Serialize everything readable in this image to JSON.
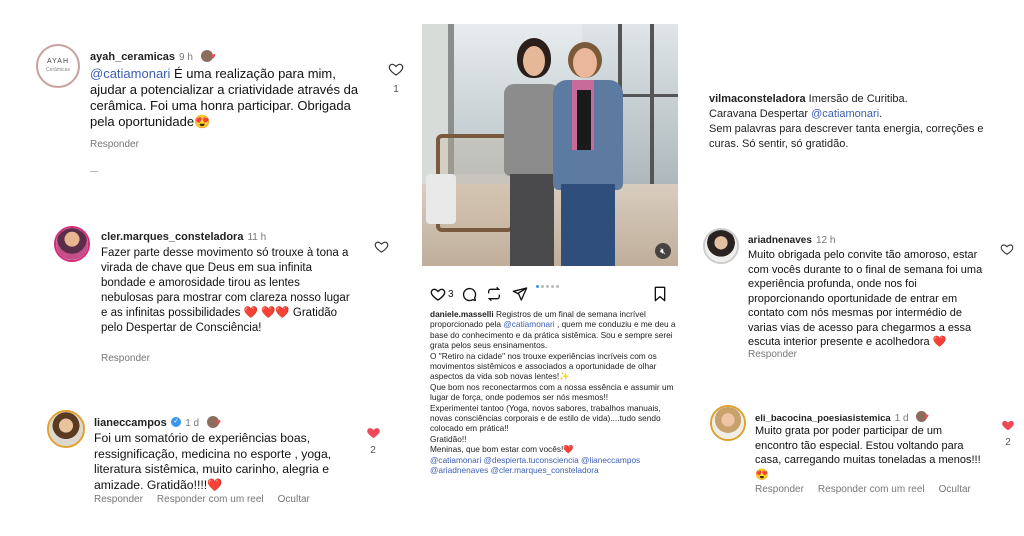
{
  "c1": {
    "username": "ayah_ceramicas",
    "ago": "9 h",
    "avatar_text": "AYAH",
    "avatar_sub": "Cerâmicas",
    "mention": "@catiamonari",
    "text_rest": " É uma realização para mim, ajudar a potencializar a criatividade através da cerâmica. Foi uma honra participar. Obrigada pela oportunidade😍",
    "reply": "Responder",
    "likes": "1"
  },
  "c2": {
    "username": "cler.marques_consteladora",
    "ago": "11 h",
    "text": "Fazer parte desse movimento só trouxe à tona a virada de chave que Deus em sua infinita bondade e amorosidade tirou as lentes nebulosas para mostrar com clareza nosso lugar e as infinitas possibilidades ❤️ ❤️❤️ Gratidão pelo Despertar de Consciência!",
    "reply": "Responder"
  },
  "c3": {
    "username": "lianeccampos",
    "ago": "1 d",
    "text": "Foi um somatório de experiências boas, ressignificação, medicina no esporte , yoga, literatura sistêmica, muito carinho, alegria e amizade. Gratidão!!!!❤️",
    "reply": "Responder",
    "reply_reel": "Responder com um reel",
    "hide": "Ocultar",
    "likes": "2"
  },
  "post": {
    "likes_count": "3",
    "username": "daniele.masselli",
    "caption_1": " Registros de um final de semana incrível proporcionado pela ",
    "caption_mention": "@catiamonari",
    "caption_2": " , quem me conduziu e me deu a base do conhecimento e da prática sistêmica. Sou e sempre serei grata pelos seus ensinamentos.",
    "caption_3": "O \"Retiro na cidade\" nos trouxe experiências incríveis com os movimentos sistêmicos e associados a oportunidade de olhar aspectos da vida sob novas lentes!✨",
    "caption_4": "Que bom nos reconectarmos com a nossa essência e assumir um lugar de força, onde podemos ser nós mesmos!!",
    "caption_5": "Experimentei tantoo (Yoga, novos sabores, trabalhos manuais, novas consciências corporais e de estilo de vida)....tudo sendo colocado em prática!!",
    "caption_6": "Gratidão!!",
    "caption_7": "Meninas, que bom estar com vocês!❤️",
    "tags_1": "@catiamonari @despierta.tuconsciencia @lianeccampos",
    "tags_2": "@ariadnenaves @cler.marques_consteladora"
  },
  "c4": {
    "username": "vilmaconsteladora",
    "line1_rest": " Imersão de Curitiba.",
    "line2_a": "Caravana Despertar ",
    "line2_mention": "@catiamonari",
    "line2_b": ".",
    "line3": "Sem palavras para descrever tanta energia, correções e curas. Só sentir, só gratidão."
  },
  "c5": {
    "username": "ariadnenaves",
    "ago": "12 h",
    "text": "Muito obrigada pelo convite tão amoroso, estar com vocês durante to o final de semana foi uma experiência profunda, onde nos foi proporcionando oportunidade de entrar em contato com nós mesmas por intermédio de varias vias de acesso para chegarmos a essa escuta interior presente e acolhedora ❤️",
    "reply": "Responder"
  },
  "c6": {
    "username": "eli_bacocina_poesiasistemica",
    "ago": "1 d",
    "text": "Muito grata por poder participar de um encontro tão especial. Estou voltando para casa,  carregando muitas toneladas a menos!!! 😍",
    "reply": "Responder",
    "reply_reel": "Responder com um reel",
    "hide": "Ocultar",
    "likes": "2"
  },
  "colors": {
    "like_red": "#ed4956",
    "mention_blue": "#3b5db3",
    "meta_gray": "#777777"
  },
  "icons": [
    "heart-outline-icon",
    "heart-filled-icon",
    "comment-icon",
    "repost-icon",
    "share-icon",
    "bookmark-icon",
    "mute-icon",
    "verified-icon"
  ]
}
